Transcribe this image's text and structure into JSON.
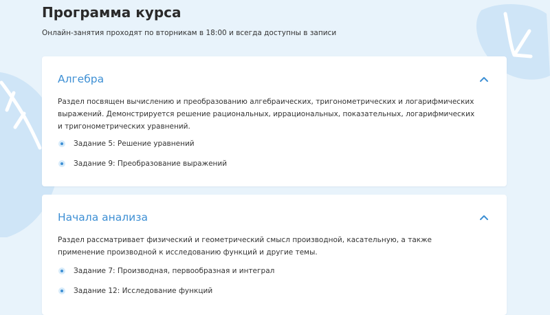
{
  "page": {
    "title": "Программа курса",
    "subtitle": "Онлайн-занятия проходят по вторникам в 18:00 и всегда доступны в записи"
  },
  "colors": {
    "accent": "#3d8fd4",
    "background": "#e8f3fb",
    "card": "#ffffff",
    "decor": "#cfe5f7"
  },
  "sections": [
    {
      "title": "Алгебра",
      "expanded": true,
      "toggle_icon": "chevron-up-icon",
      "description": "Раздел посвящен вычислению и преобразованию алгебраических, тригонометрических и логарифмических выражений. Демонстрируется решение рациональных, иррациональных, показательных, логарифмических и тригонометрических уравнений.",
      "tasks": [
        "Задание 5: Решение уравнений",
        "Задание 9: Преобразование выражений"
      ]
    },
    {
      "title": "Начала анализа",
      "expanded": true,
      "toggle_icon": "chevron-up-icon",
      "description": "Раздел рассматривает физический и геометрический смысл производной, касательную, а также применение производной к исследованию функций и другие темы.",
      "tasks": [
        "Задание 7: Производная, первообразная и интеграл",
        "Задание 12: Исследование функций"
      ]
    }
  ]
}
